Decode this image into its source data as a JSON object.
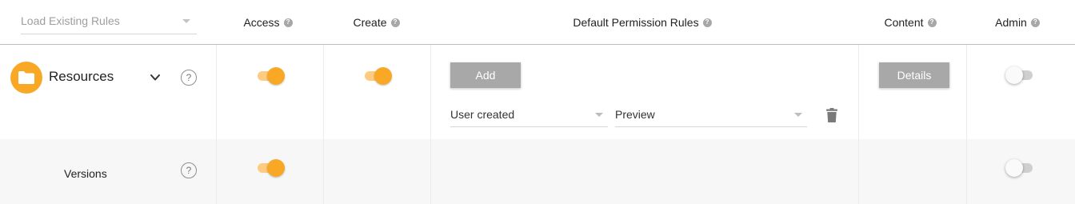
{
  "header": {
    "load_select": {
      "value": "Load Existing Rules"
    },
    "columns": {
      "access": "Access",
      "create": "Create",
      "default_rules": "Default Permission Rules",
      "content": "Content",
      "admin": "Admin"
    }
  },
  "rows": [
    {
      "name": "Resources",
      "icon": "folder-icon",
      "expanded": true,
      "access_on": true,
      "create_on": true,
      "admin_on": false,
      "add_label": "Add",
      "details_label": "Details",
      "rule": {
        "source": "User created",
        "permission": "Preview"
      }
    },
    {
      "name": "Versions",
      "access_on": true,
      "admin_on": false
    }
  ],
  "help_glyph": "?",
  "colors": {
    "accent": "#f9a825",
    "accent_light": "#ffcb80",
    "button_gray": "#a8a8a8",
    "row_alt": "#f7f7f7"
  }
}
